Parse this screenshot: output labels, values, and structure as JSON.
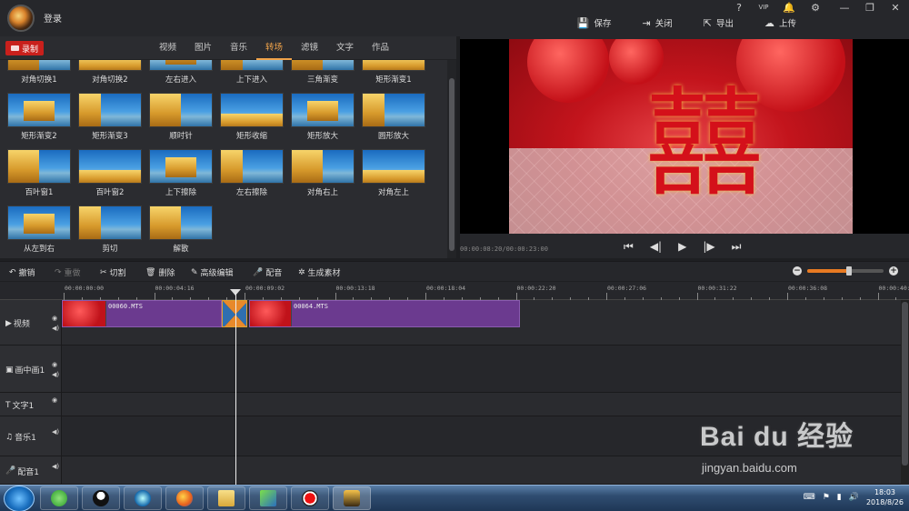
{
  "titlebar": {
    "login": "登录",
    "sys_help": "?",
    "sys_vip": "VIP",
    "sys_bell": "🔔",
    "sys_gear": "⚙",
    "sys_min": "—",
    "sys_max": "❐",
    "sys_close": "✕",
    "actions": [
      "保存",
      "关闭",
      "导出",
      "上传"
    ]
  },
  "media": {
    "record_label": "录制",
    "tabs": [
      "视频",
      "图片",
      "音乐",
      "转场",
      "滤镜",
      "文字",
      "作品"
    ],
    "active_tab": "转场",
    "transitions": [
      "对角切换1",
      "对角切换2",
      "左右进入",
      "上下进入",
      "三角渐变",
      "矩形渐变1",
      "矩形渐变2",
      "矩形渐变3",
      "顺时针",
      "矩形收缩",
      "矩形放大",
      "圆形放大",
      "百叶窗1",
      "百叶窗2",
      "上下擦除",
      "左右擦除",
      "对角右上",
      "对角左上",
      "从左到右",
      "剪切",
      "解散"
    ]
  },
  "preview": {
    "glyph": "囍",
    "timecode": "00:00:08:20/00:00:23:00",
    "controls": [
      "⏮",
      "◀|",
      "▶",
      "|▶",
      "⏭"
    ]
  },
  "toolbar": {
    "undo": "撤销",
    "redo": "重做",
    "cut": "切割",
    "delete": "删除",
    "advanced_edit": "高级编辑",
    "dub": "配音",
    "generate": "生成素材",
    "zoom_minus": "−",
    "zoom_plus": "+",
    "zoom_level": 0.55
  },
  "timeline": {
    "ruler": [
      "00:00:00:00",
      "00:00:04:16",
      "00:00:09:02",
      "00:00:13:18",
      "00:00:18:04",
      "00:00:22:20",
      "00:00:27:06",
      "00:00:31:22",
      "00:00:36:08",
      "00:00:40:"
    ],
    "tracks": [
      {
        "name": "视频",
        "icon": "▶"
      },
      {
        "name": "画中画1",
        "icon": "▣"
      },
      {
        "name": "文字1",
        "icon": "T"
      },
      {
        "name": "音乐1",
        "icon": "♫"
      },
      {
        "name": "配音1",
        "icon": "🎤"
      }
    ],
    "clips": [
      "00060.MTS",
      "00064.MTS"
    ]
  },
  "taskbar": {
    "time": "18:03",
    "date": "2018/8/26"
  },
  "watermark": {
    "line1": "Bai du 经验",
    "line2": "jingyan.baidu.com"
  },
  "colors": {
    "accent": "#f0a34a",
    "record": "#c9201c",
    "clip": "#6b3a8f"
  }
}
